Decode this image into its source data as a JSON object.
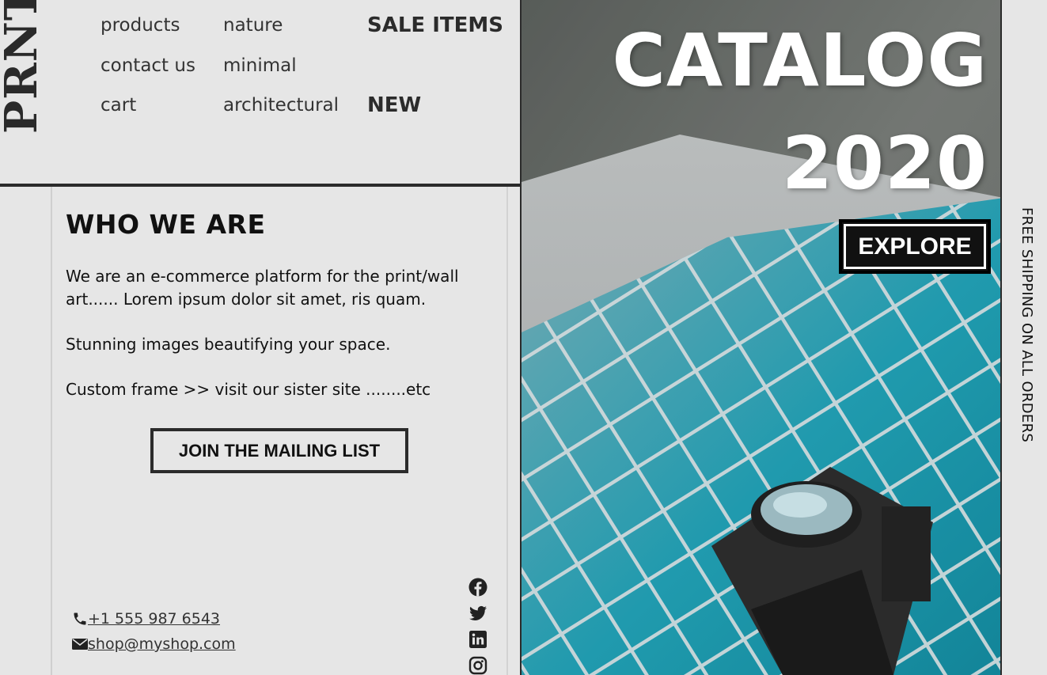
{
  "logo": "PRNT",
  "nav": {
    "col1": [
      "products",
      "contact us",
      "cart"
    ],
    "col2": [
      "nature",
      "minimal",
      "architectural"
    ],
    "col3": [
      "SALE ITEMS",
      "NEW"
    ]
  },
  "about": {
    "heading": "WHO WE ARE",
    "p1": "We are an e-commerce platform for the print/wall art...... Lorem ipsum dolor sit amet, ris quam.",
    "p2": "Stunning images beautifying your space.",
    "p3": "Custom frame >> visit our sister site ........etc",
    "join_label": "JOIN THE MAILING LIST"
  },
  "contact": {
    "phone": "+1 555 987 6543",
    "email": " shop@myshop.com"
  },
  "social": [
    "facebook-icon",
    "twitter-icon",
    "linkedin-icon",
    "instagram-icon"
  ],
  "hero": {
    "line1": "CATALOG",
    "line2": "2020",
    "explore_label": "EXPLORE"
  },
  "shipping_banner": "FREE SHIPPING ON ALL ORDERS",
  "colors": {
    "dark": "#2b2b2b",
    "page_bg": "#e6e6e6",
    "hero_teal": "#16a7b8"
  }
}
